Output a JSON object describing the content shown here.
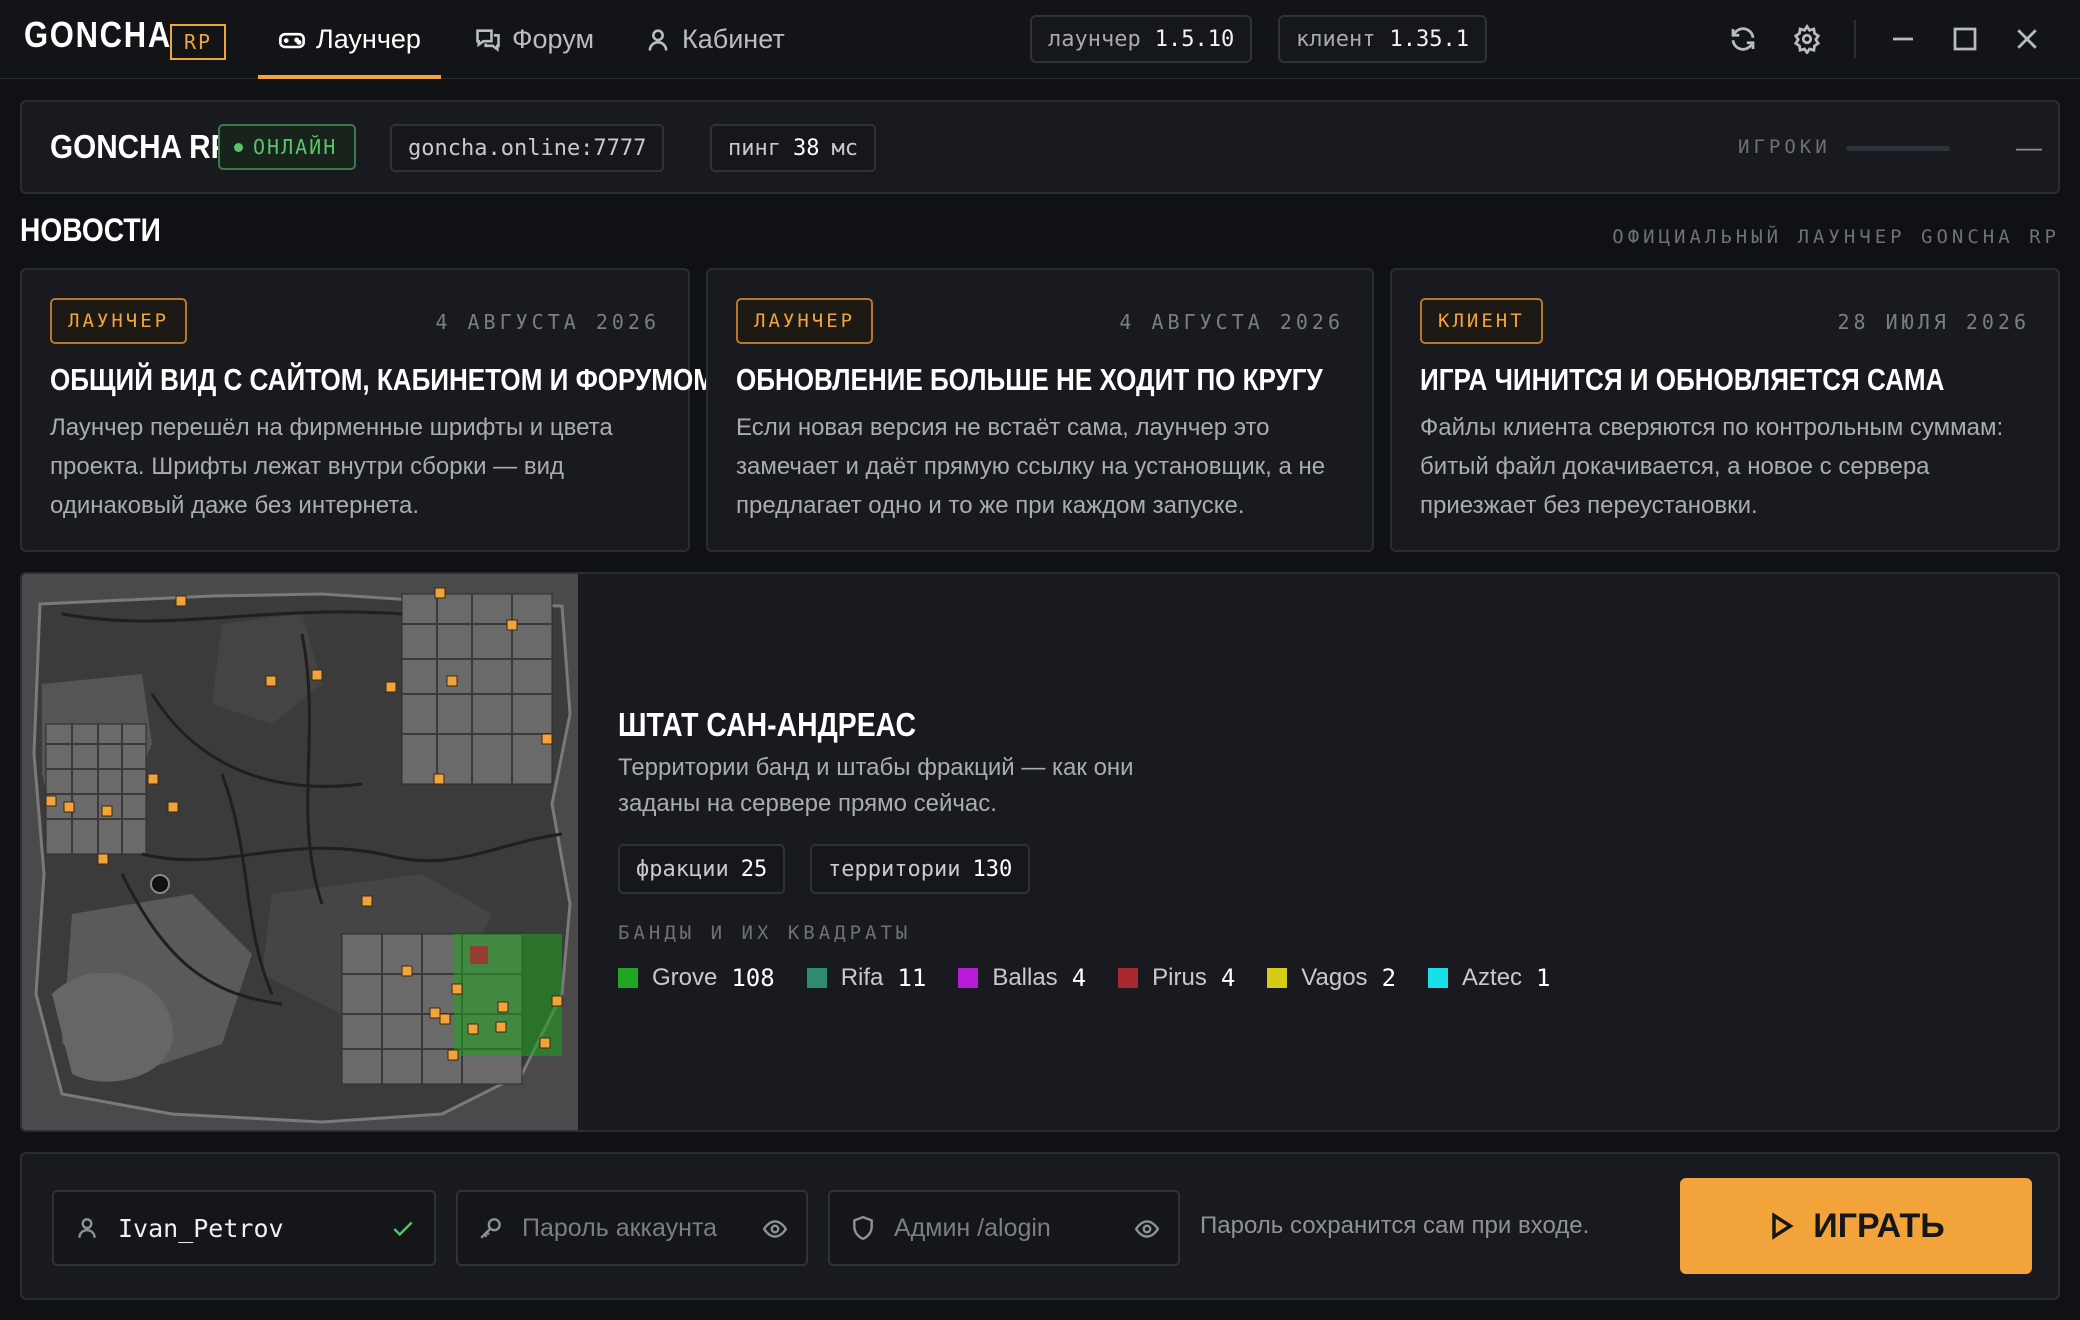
{
  "app": {
    "logo": "GONCHA",
    "logo_badge": "RP"
  },
  "tabs": [
    {
      "label": "Лаунчер",
      "icon": "gamepad-icon",
      "active": true
    },
    {
      "label": "Форум",
      "icon": "chat-icon",
      "active": false
    },
    {
      "label": "Кабинет",
      "icon": "user-icon",
      "active": false
    }
  ],
  "versions": {
    "launcher_label": "лаунчер",
    "launcher_value": "1.5.10",
    "client_label": "клиент",
    "client_value": "1.35.1"
  },
  "window_controls": [
    "refresh-icon",
    "settings-icon",
    "minimize-icon",
    "maximize-icon",
    "close-icon"
  ],
  "server": {
    "name": "GONCHA RP",
    "status": "ОНЛАЙН",
    "address": "goncha.online:7777",
    "ping_label": "пинг",
    "ping_value": "38",
    "ping_unit": "мс",
    "players_label": "ИГРОКИ",
    "players_value": "—"
  },
  "news": {
    "title": "НОВОСТИ",
    "subtitle": "ОФИЦИАЛЬНЫЙ ЛАУНЧЕР GONCHA RP",
    "items": [
      {
        "tag": "ЛАУНЧЕР",
        "date": "4 АВГУСТА 2026",
        "title": "ОБЩИЙ ВИД С САЙТОМ, КАБИНЕТОМ И ФОРУМОМ",
        "text": "Лаунчер перешёл на фирменные шрифты и цвета проекта. Шрифты лежат внутри сборки — вид одинаковый даже без интернета."
      },
      {
        "tag": "ЛАУНЧЕР",
        "date": "4 АВГУСТА 2026",
        "title": "ОБНОВЛЕНИЕ БОЛЬШЕ НЕ ХОДИТ ПО КРУГУ",
        "text": "Если новая версия не встаёт сама, лаунчер это замечает и даёт прямую ссылку на установщик, а не предлагает одно и то же при каждом запуске."
      },
      {
        "tag": "КЛИЕНТ",
        "date": "28 ИЮЛЯ 2026",
        "title": "ИГРА ЧИНИТСЯ И ОБНОВЛЯЕТСЯ САМА",
        "text": "Файлы клиента сверяются по контрольным суммам: битый файл докачивается, а новое с сервера приезжает без переустановки."
      }
    ]
  },
  "state": {
    "title": "ШТАТ САН-АНДРЕАС",
    "description": "Территории банд и штабы фракций — как они заданы на сервере прямо сейчас.",
    "factions_label": "фракции",
    "factions_value": "25",
    "territories_label": "территории",
    "territories_value": "130",
    "gangs_label": "БАНДЫ И ИХ КВАДРАТЫ",
    "gangs": [
      {
        "name": "Grove",
        "count": "108",
        "color": "#22a722"
      },
      {
        "name": "Rifa",
        "count": "11",
        "color": "#2e8c6e"
      },
      {
        "name": "Ballas",
        "count": "4",
        "color": "#b81cd6"
      },
      {
        "name": "Pirus",
        "count": "4",
        "color": "#a82a30"
      },
      {
        "name": "Vagos",
        "count": "2",
        "color": "#d6cc16"
      },
      {
        "name": "Aztec",
        "count": "1",
        "color": "#18e0e8"
      }
    ]
  },
  "login": {
    "username": "Ivan_Petrov",
    "password_placeholder": "Пароль аккаунта",
    "admin_placeholder": "Админ /alogin",
    "hint": "Пароль сохранится сам при входе.",
    "play_label": "ИГРАТЬ"
  },
  "colors": {
    "accent": "#f2a33a",
    "online": "#58c36b",
    "bg": "#0f1115",
    "panel": "#181a1f"
  }
}
